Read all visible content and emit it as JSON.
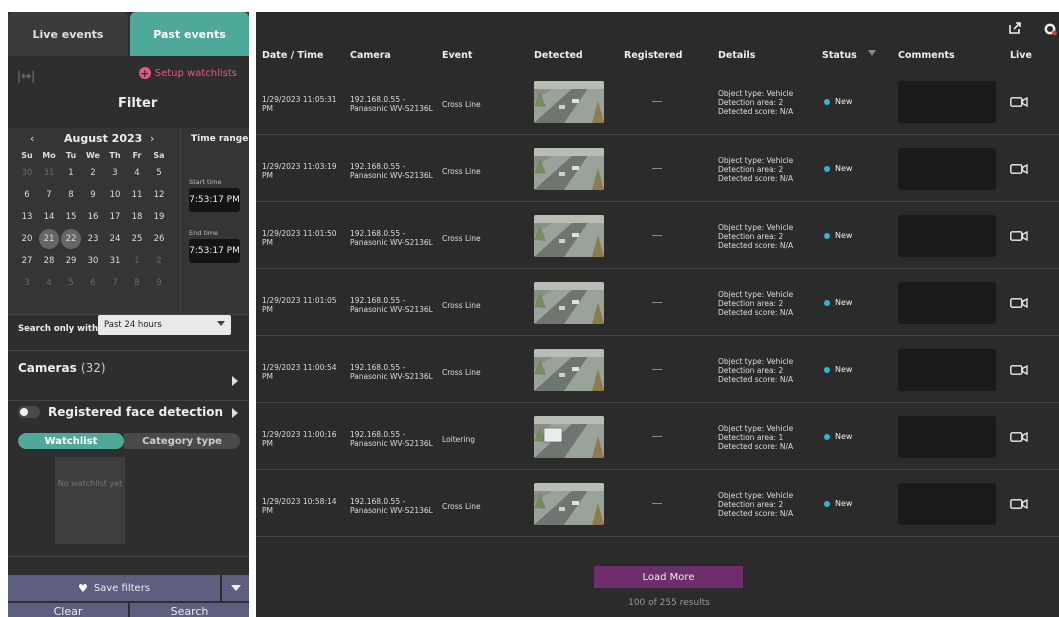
{
  "tabs": {
    "live": "Live events",
    "past": "Past events"
  },
  "filter": {
    "setup_watchlists": "Setup watchlists",
    "title": "Filter"
  },
  "calendar": {
    "month": "August 2023",
    "prev": "‹",
    "next": "›",
    "dow": [
      "Su",
      "Mo",
      "Tu",
      "We",
      "Th",
      "Fr",
      "Sa"
    ],
    "weeks": [
      [
        "30",
        "31",
        "1",
        "2",
        "3",
        "4",
        "5"
      ],
      [
        "6",
        "7",
        "8",
        "9",
        "10",
        "11",
        "12"
      ],
      [
        "13",
        "14",
        "15",
        "16",
        "17",
        "18",
        "19"
      ],
      [
        "20",
        "21",
        "22",
        "23",
        "24",
        "25",
        "26"
      ],
      [
        "27",
        "28",
        "29",
        "30",
        "31",
        "1",
        "2"
      ],
      [
        "3",
        "4",
        "5",
        "6",
        "7",
        "8",
        "9"
      ]
    ]
  },
  "time_range": {
    "title": "Time range",
    "start_label": "Start time",
    "start_value": "7:53:17 PM",
    "end_label": "End time",
    "end_value": "7:53:17 PM"
  },
  "search_within": {
    "label": "Search only within",
    "value": "Past 24 hours"
  },
  "cameras": {
    "label": "Cameras",
    "count": "(32)"
  },
  "face": {
    "label": "Registered face detection",
    "seg_a": "Watchlist",
    "seg_b": "Category type",
    "empty": "No watchlist yet"
  },
  "actions": {
    "save": "Save filters",
    "clear": "Clear",
    "search": "Search"
  },
  "table": {
    "headers": {
      "date": "Date / Time",
      "camera": "Camera",
      "event": "Event",
      "detected": "Detected",
      "registered": "Registered",
      "details": "Details",
      "status": "Status",
      "comments": "Comments",
      "live": "Live"
    },
    "rows": [
      {
        "date": "1/29/2023 11:05:31 PM",
        "camera": "192.168.0.55 - Panasonic WV-S2136L",
        "event": "Cross Line",
        "d1": "Object type: Vehicle",
        "d2": "Detection area: 2",
        "d3": "Detected score: N/A",
        "status": "New"
      },
      {
        "date": "1/29/2023 11:03:19 PM",
        "camera": "192.168.0.55 - Panasonic WV-S2136L",
        "event": "Cross Line",
        "d1": "Object type: Vehicle",
        "d2": "Detection area: 2",
        "d3": "Detected score: N/A",
        "status": "New"
      },
      {
        "date": "1/29/2023 11:01:50 PM",
        "camera": "192.168.0.55 - Panasonic WV-S2136L",
        "event": "Cross Line",
        "d1": "Object type: Vehicle",
        "d2": "Detection area: 2",
        "d3": "Detected score: N/A",
        "status": "New"
      },
      {
        "date": "1/29/2023 11:01:05 PM",
        "camera": "192.168.0.55 - Panasonic WV-S2136L",
        "event": "Cross Line",
        "d1": "Object type: Vehicle",
        "d2": "Detection area: 2",
        "d3": "Detected score: N/A",
        "status": "New"
      },
      {
        "date": "1/29/2023 11:00:54 PM",
        "camera": "192.168.0.55 - Panasonic WV-S2136L",
        "event": "Cross Line",
        "d1": "Object type: Vehicle",
        "d2": "Detection area: 2",
        "d3": "Detected score: N/A",
        "status": "New"
      },
      {
        "date": "1/29/2023 11:00:16 PM",
        "camera": "192.168.0.55 - Panasonic WV-S2136L",
        "event": "Loitering",
        "d1": "Object type: Vehicle",
        "d2": "Detection area: 1",
        "d3": "Detected score: N/A",
        "status": "New"
      },
      {
        "date": "1/29/2023 10:58:14 PM",
        "camera": "192.168.0.55 - Panasonic WV-S2136L",
        "event": "Cross Line",
        "d1": "Object type: Vehicle",
        "d2": "Detection area: 2",
        "d3": "Detected score: N/A",
        "status": "New"
      }
    ]
  },
  "footer": {
    "load_more": "Load More",
    "results": "100 of 255 results"
  },
  "colors": {
    "accent": "#4ea99a",
    "status_new": "#29b9d8",
    "load_more": "#6d2e6b",
    "setup_link": "#e05a8a"
  }
}
